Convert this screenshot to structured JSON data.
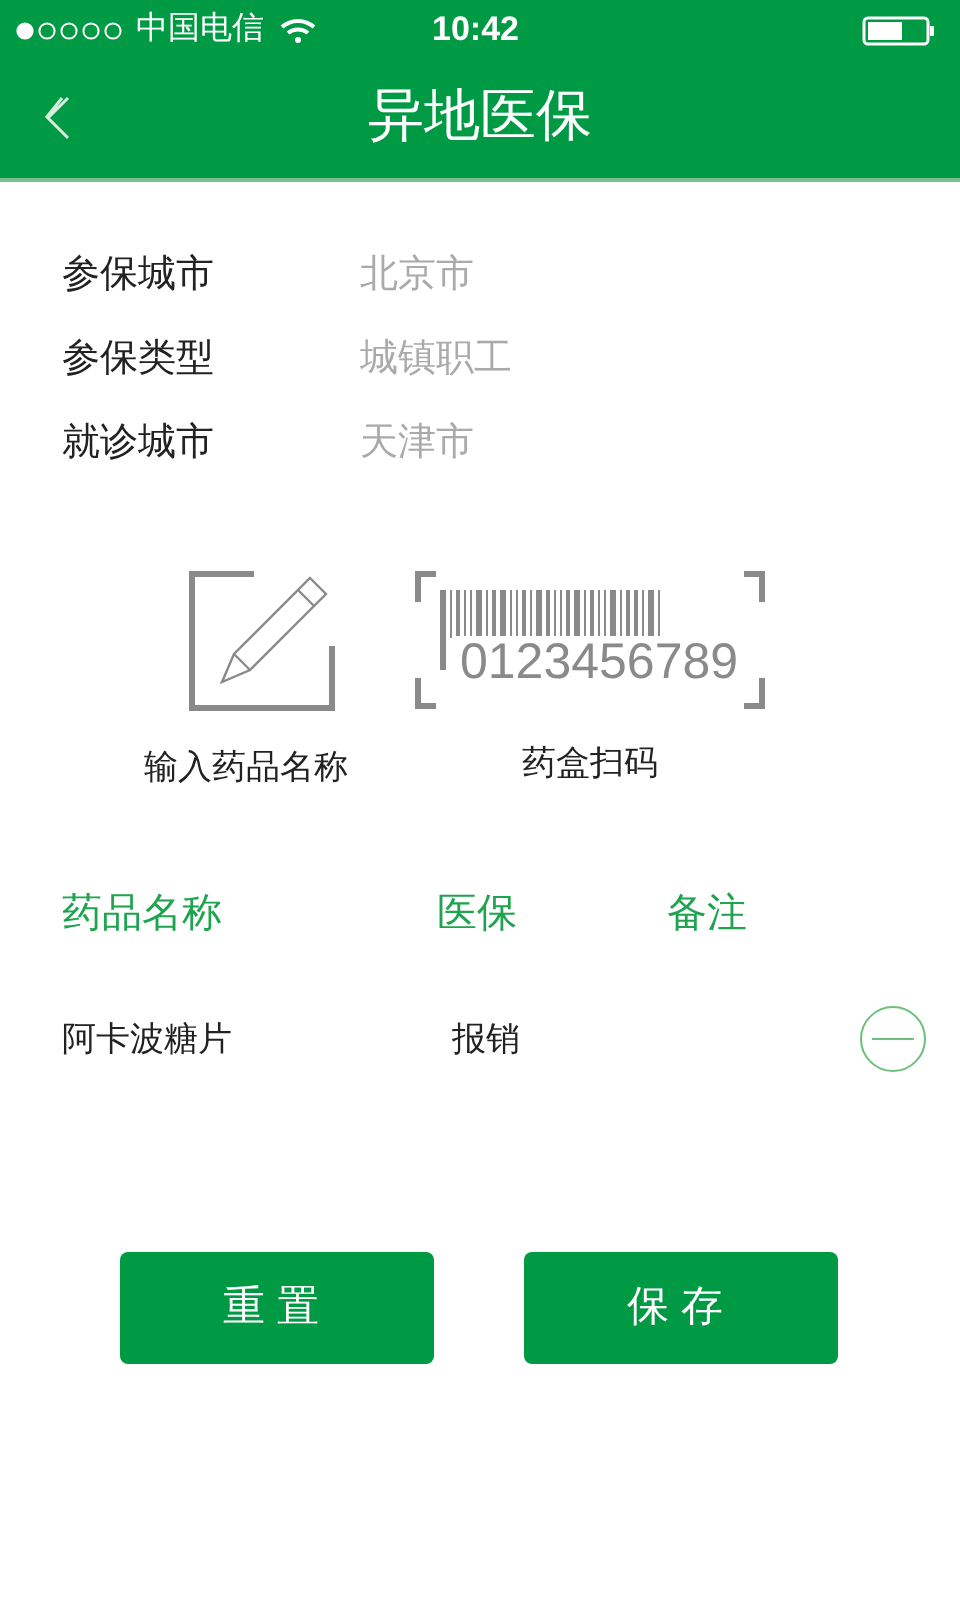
{
  "status_bar": {
    "carrier": "中国电信",
    "time": "10:42"
  },
  "header": {
    "title": "异地医保"
  },
  "info": [
    {
      "label": "参保城市",
      "value": "北京市"
    },
    {
      "label": "参保类型",
      "value": "城镇职工"
    },
    {
      "label": "就诊城市",
      "value": "天津市"
    }
  ],
  "actions": [
    {
      "kind": "input",
      "label": "输入药品名称"
    },
    {
      "kind": "scan",
      "label": "药盒扫码",
      "barcode_digits": "0123456789"
    }
  ],
  "table": {
    "columns": [
      "药品名称",
      "医保",
      "备注"
    ],
    "rows": [
      {
        "name": "阿卡波糖片",
        "insurance": "报销"
      }
    ]
  },
  "buttons": [
    "重置",
    "保存"
  ]
}
